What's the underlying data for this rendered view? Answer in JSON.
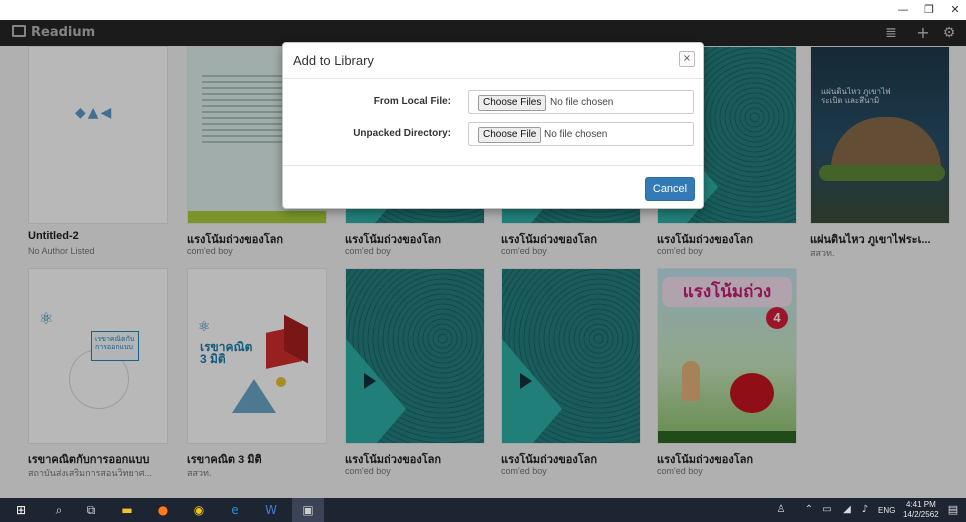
{
  "window": {
    "minimize_glyph": "—",
    "restore_glyph": "❐",
    "close_glyph": "✕"
  },
  "app": {
    "name": "Readium",
    "toolbar": {
      "list_view_icon": "list-icon",
      "add_icon": "plus-icon",
      "settings_icon": "gear-icon"
    }
  },
  "library": {
    "books": [
      {
        "title": "Untitled-2",
        "author": "No Author Listed",
        "cover": "white"
      },
      {
        "title": "แรงโน้มถ่วงของโลก",
        "author": "com'ed boy",
        "cover": "text"
      },
      {
        "title": "แรงโน้มถ่วงของโลก",
        "author": "com'ed boy",
        "cover": "teal"
      },
      {
        "title": "แรงโน้มถ่วงของโลก",
        "author": "com'ed boy",
        "cover": "teal"
      },
      {
        "title": "แรงโน้มถ่วงของโลก",
        "author": "com'ed boy",
        "cover": "teal"
      },
      {
        "title": "แผ่นดินไหว ภูเขาไฟระเ...",
        "author": "สสวท.",
        "cover": "dark",
        "cover_text": "แผ่นดินไหว ภูเขาไฟระเบิด และสึนามิ"
      },
      {
        "title": "เรขาคณิตกับการออกแบบ",
        "author": "สถาบันส่งเสริมการสอนวิทยาศ...",
        "cover": "math",
        "cover_text": "เรขาคณิตกับ การออกแบบ"
      },
      {
        "title": "เรขาคณิต 3 มิติ",
        "author": "สสวท.",
        "cover": "math2",
        "cover_text": "เรขาคณิต 3 มิติ"
      },
      {
        "title": "แรงโน้มถ่วงของโลก",
        "author": "com'ed boy",
        "cover": "teal"
      },
      {
        "title": "แรงโน้มถ่วงของโลก",
        "author": "com'ed boy",
        "cover": "teal"
      },
      {
        "title": "แรงโน้มถ่วงของโลก",
        "author": "com'ed boy",
        "cover": "apple",
        "cover_text": "แรงโน้มถ่วง",
        "cover_number": "4"
      }
    ]
  },
  "modal": {
    "title": "Add to Library",
    "close_glyph": "×",
    "local_file_label": "From Local File:",
    "local_file_button": "Choose Files",
    "local_file_status": "No file chosen",
    "unpacked_label": "Unpacked Directory:",
    "unpacked_button": "Choose File",
    "unpacked_status": "No file chosen",
    "cancel_label": "Cancel"
  },
  "taskbar": {
    "language": "ENG",
    "time": "4:41 PM",
    "date": "14/2/2562"
  }
}
